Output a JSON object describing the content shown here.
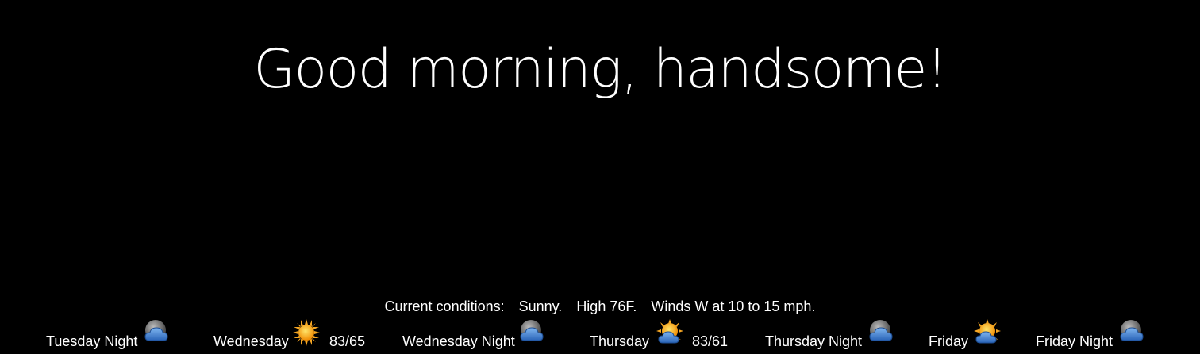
{
  "greeting": "Good morning, handsome!",
  "current": {
    "label": "Current conditions:",
    "sky": "Sunny.",
    "high": "High 76F.",
    "winds": "Winds W at 10 to 15 mph."
  },
  "forecast": [
    {
      "name": "Tuesday Night",
      "icon": "night-cloudy-icon",
      "temp": ""
    },
    {
      "name": "Wednesday",
      "icon": "sunny-icon",
      "temp": "83/65"
    },
    {
      "name": "Wednesday Night",
      "icon": "night-cloudy-icon",
      "temp": ""
    },
    {
      "name": "Thursday",
      "icon": "partly-sunny-icon",
      "temp": "83/61"
    },
    {
      "name": "Thursday Night",
      "icon": "night-cloudy-icon",
      "temp": ""
    },
    {
      "name": "Friday",
      "icon": "partly-sunny-icon",
      "temp": ""
    },
    {
      "name": "Friday Night",
      "icon": "night-cloudy-icon",
      "temp": ""
    }
  ],
  "colors": {
    "background": "#000000",
    "text": "#ffffff",
    "sun": "#f5a623",
    "cloud": "#3d7fd6",
    "moon": "#8a8a8a"
  }
}
